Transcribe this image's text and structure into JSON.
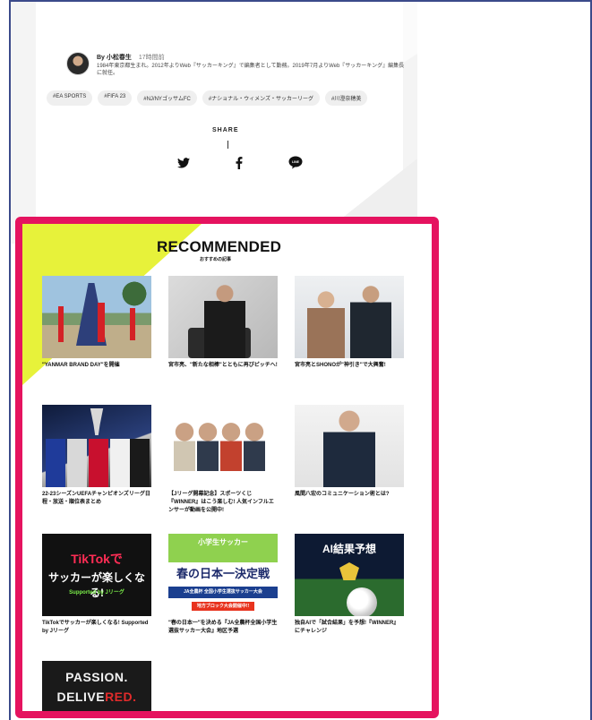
{
  "top_faded_text": "",
  "author": {
    "by": "By 小松春生",
    "time_ago": "17時間前",
    "bio": "1984年東京都生まれ。2012年よりWeb『サッカーキング』で編集者として勤務。2019年7月よりWeb『サッカーキング』編集長に就任。"
  },
  "tags": [
    "#EA SPORTS",
    "#FIFA 23",
    "#NJ/NYゴッサムFC",
    "#ナショナル・ウィメンズ・サッカーリーグ",
    "#川澄奈穂美"
  ],
  "share": {
    "label": "SHARE",
    "icons": [
      "twitter-icon",
      "facebook-icon",
      "line-icon"
    ],
    "line_text": "LINE"
  },
  "recommended": {
    "title": "RECOMMENDED",
    "subtitle": "おすすめの記事",
    "items": [
      {
        "title": "\"YANMAR BRAND DAY\"を開催"
      },
      {
        "title": "宮市亮、\"新たな相棒\"とともに再びピッチへ!"
      },
      {
        "title": "宮市亮とSHONOが\"神引き\"で大興奮!"
      },
      {
        "title": "22-23シーズンUEFAチャンピオンズリーグ日程・放送・順位表まとめ"
      },
      {
        "title": "【Jリーグ開幕記念】スポーツくじ『WINNER』はこう楽しむ! 人気インフルエンサーが動画を公開中!"
      },
      {
        "title": "風間八宏のコミュニケーション術とは?"
      },
      {
        "title": "TikTokでサッカーが楽しくなる! Supported by Jリーグ"
      },
      {
        "title": "\"春の日本一\"を決める『JA全農杯全国小学生選抜サッカー大会』地区予選"
      },
      {
        "title": "独自AIで「試合結果」を予想!『WINNER』にチャレンジ"
      },
      {
        "title": ""
      }
    ],
    "thumb_text": {
      "tiktok_1": "TikTokで",
      "tiktok_2": "サッカーが楽しくなる!",
      "tiktok_3": "Supported by Jリーグ",
      "ja_1": "小学生サッカー",
      "ja_2": "春の日本一決定戦",
      "ja_3": "JA全農杯 全国小学生選抜サッカー大会",
      "ja_4": "地方ブロック大会開催中!!",
      "ai_1": "AI結果予想",
      "passion_1": "PASSION.",
      "passion_2a": "DELIVE",
      "passion_2b": "RED."
    }
  },
  "colors": {
    "highlight_border": "#e5135f",
    "accent_yellow": "#e7f23a",
    "frame_border": "#3b4a8a"
  }
}
